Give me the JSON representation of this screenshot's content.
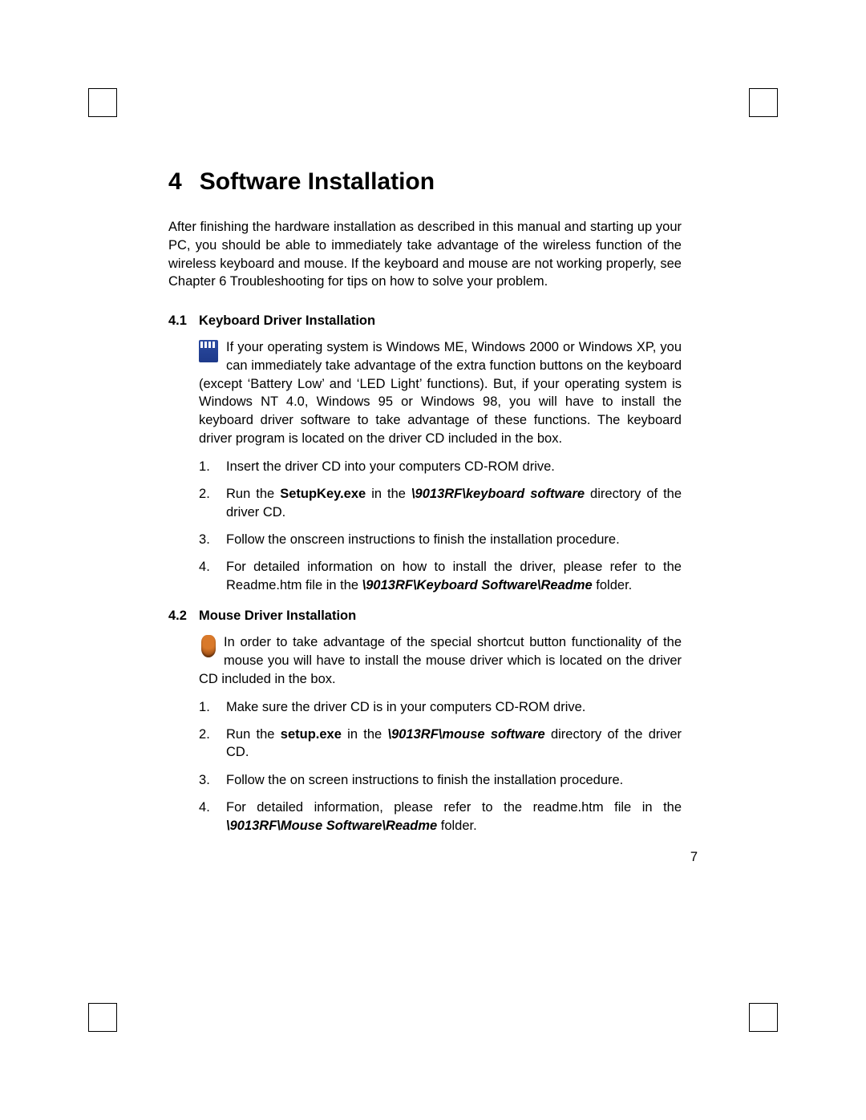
{
  "chapter": {
    "number": "4",
    "title": "Software Installation"
  },
  "intro": "After finishing the hardware installation as described in this manual and starting up your PC, you should be able to immediately take advantage of the wireless function of the wireless keyboard and mouse. If the keyboard and mouse are not working properly, see Chapter 6 Troubleshooting for tips on how to solve your problem.",
  "sections": [
    {
      "num": "4.1",
      "title": "Keyboard Driver Installation",
      "icon": "keyboard-icon",
      "lead_parts": [
        {
          "t": "If your operating system is Windows ME, Windows 2000 or Windows XP, you can immediately take advantage of the extra function buttons on the keyboard (except ‘Battery Low’ and ‘LED Light’ functions). But, if your operating system is Windows NT 4.0, Windows 95 or Windows 98, you will have to install the keyboard driver software to take advantage of these functions. The keyboard driver program is located on the driver CD included in the box."
        }
      ],
      "steps": [
        [
          {
            "t": "Insert the driver CD into your computers CD-ROM drive."
          }
        ],
        [
          {
            "t": "Run the "
          },
          {
            "t": "SetupKey.exe",
            "cls": "b"
          },
          {
            "t": " in the "
          },
          {
            "t": "\\9013RF\\keyboard software",
            "cls": "bi"
          },
          {
            "t": " directory of the driver CD."
          }
        ],
        [
          {
            "t": "Follow the onscreen instructions to finish the installation procedure."
          }
        ],
        [
          {
            "t": "For detailed information on how to install the driver, please refer to the Readme.htm file in the "
          },
          {
            "t": "\\9013RF\\Keyboard Software\\Readme",
            "cls": "bi"
          },
          {
            "t": " folder."
          }
        ]
      ]
    },
    {
      "num": "4.2",
      "title": "Mouse Driver Installation",
      "icon": "mouse-icon",
      "lead_parts": [
        {
          "t": "In order to take advantage of the special shortcut button functionality of the mouse you will have to install the mouse driver which is located on the driver CD included in the box."
        }
      ],
      "steps": [
        [
          {
            "t": "Make sure the driver CD is in your computers CD-ROM drive."
          }
        ],
        [
          {
            "t": "Run the "
          },
          {
            "t": "setup.exe",
            "cls": "b"
          },
          {
            "t": " in the "
          },
          {
            "t": "\\9013RF\\mouse software",
            "cls": "bi"
          },
          {
            "t": " directory of the driver CD."
          }
        ],
        [
          {
            "t": "Follow the on screen instructions to finish the installation procedure."
          }
        ],
        [
          {
            "t": "For detailed information, please refer to the readme.htm file in the "
          },
          {
            "t": "\\9013RF\\Mouse Software\\Readme",
            "cls": "bi"
          },
          {
            "t": " folder."
          }
        ]
      ]
    }
  ],
  "page_number": "7"
}
